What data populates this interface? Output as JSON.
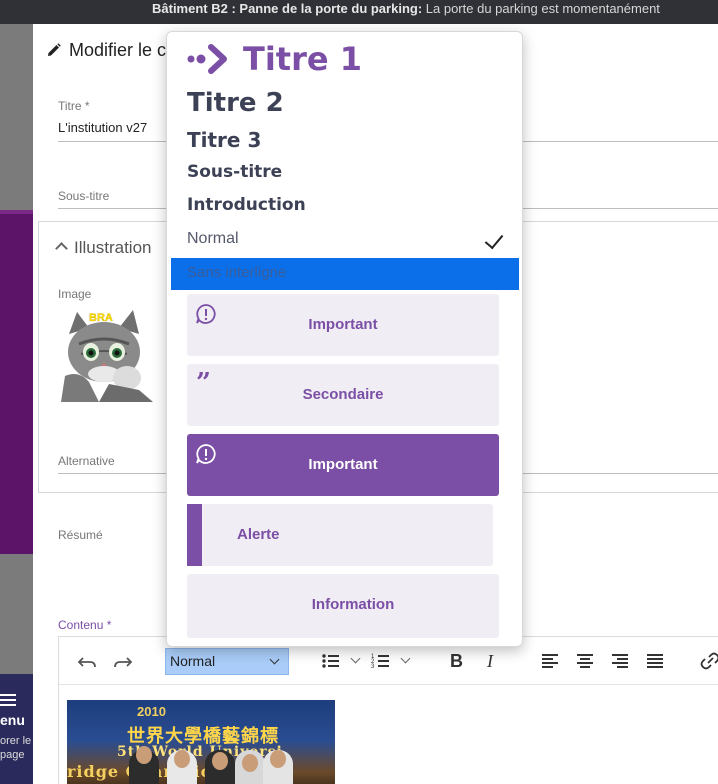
{
  "topbar": {
    "bold": "Bâtiment B2 : Panne de la porte du parking:",
    "text": " La porte du parking est momentanément"
  },
  "background": {
    "menu_label": "enu",
    "menu_sub": "orer le page"
  },
  "modal": {
    "title": "Modifier le c",
    "fields": {
      "titre_label": "Titre *",
      "titre_value": "L'institution v27",
      "soustitre_label": "Sous-titre",
      "section_title": "Illustration",
      "image_label": "Image",
      "alternative_label": "Alternative",
      "resume_label": "Résumé",
      "contenu_label": "Contenu *"
    },
    "cat_caption": "BRA"
  },
  "editor": {
    "style_value": "Normal",
    "undo_icon": "undo-icon",
    "redo_icon": "redo-icon",
    "bold_label": "B",
    "italic_label": "I",
    "photo": {
      "year": "2010",
      "banner": "世界大學橋藝錦標",
      "line3": "5th World Universi",
      "line4": "ridge Championsh"
    }
  },
  "dropdown": {
    "items": {
      "titre1": "Titre 1",
      "titre2": "Titre 2",
      "titre3": "Titre 3",
      "sous_titre": "Sous-titre",
      "introduction": "Introduction",
      "normal": "Normal",
      "sans_interligne": "Sans interligne",
      "important_1": "Important",
      "secondaire": "Secondaire",
      "important_2": "Important",
      "alerte": "Alerte",
      "information": "Information"
    },
    "selected": "Normal",
    "colors": {
      "accent": "#7b4fa5",
      "highlight": "#0a6fe8"
    }
  }
}
